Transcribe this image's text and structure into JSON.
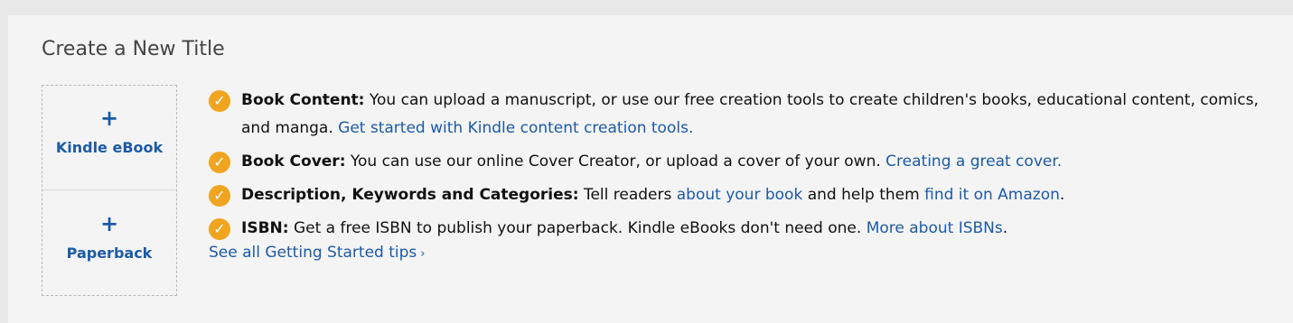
{
  "title": "Create a New Title",
  "cards": [
    {
      "plus": "+",
      "label": "Kindle eBook"
    },
    {
      "plus": "+",
      "label": "Paperback"
    }
  ],
  "tips": {
    "content": {
      "heading": "Book Content:",
      "text": " You can upload a manuscript, or use our free creation tools to create children's books, educational content, comics, and manga. ",
      "link": "Get started with Kindle content creation tools."
    },
    "cover": {
      "heading": "Book Cover:",
      "text": " You can use our online Cover Creator, or upload a cover of your own. ",
      "link": "Creating a great cover."
    },
    "description": {
      "heading": "Description, Keywords and Categories:",
      "text1": " Tell readers ",
      "link1": "about your book",
      "text2": " and help them ",
      "link2": "find it on Amazon",
      "text3": "."
    },
    "isbn": {
      "heading": "ISBN:",
      "text": " Get a free ISBN to publish your paperback. Kindle eBooks don't need one. ",
      "link": "More about ISBNs",
      "text2": "."
    }
  },
  "see_all": "See all Getting Started tips",
  "see_all_chevron": "›",
  "check_glyph": "✓",
  "colors": {
    "link": "#1d5aa6",
    "check": "#f0a521",
    "panel": "#f4f4f4"
  }
}
